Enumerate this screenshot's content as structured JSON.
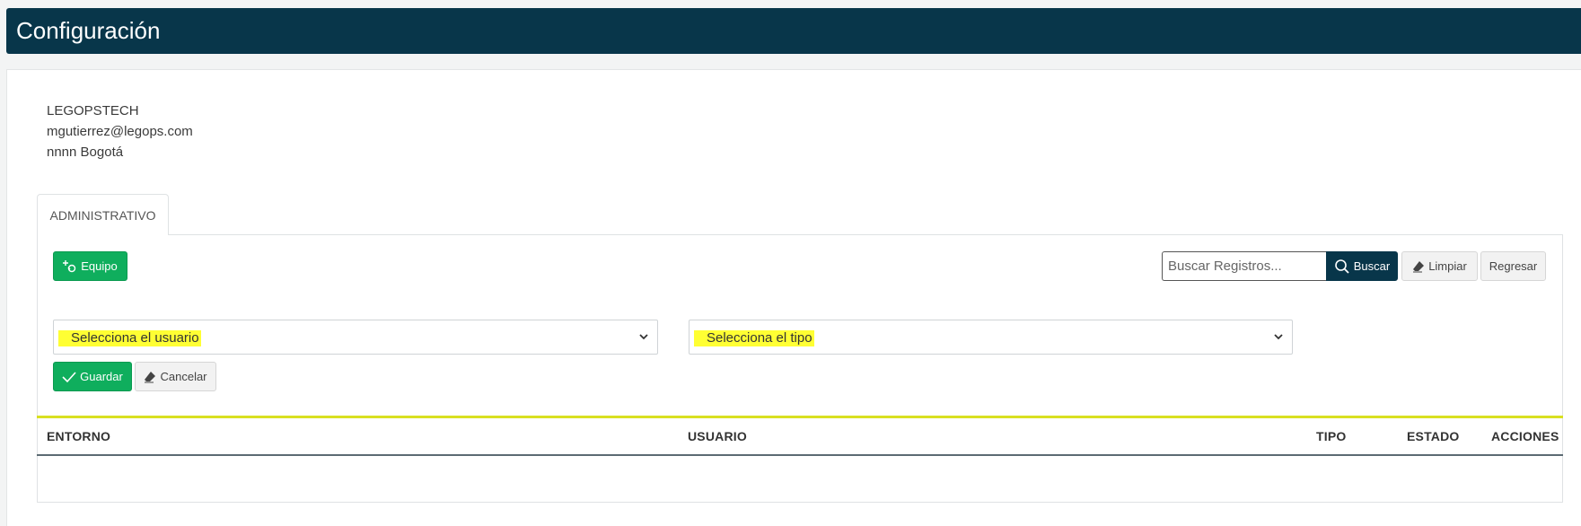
{
  "header": {
    "title": "Configuración"
  },
  "account": {
    "company": "LEGOPSTECH",
    "email": "mgutierrez@legops.com",
    "location": "nnnn Bogotá"
  },
  "tabs": [
    {
      "label": "ADMINISTRATIVO",
      "active": true
    }
  ],
  "toolbar": {
    "add_team_label": "Equipo",
    "search_placeholder": "Buscar Registros...",
    "search_value": "",
    "search_label": "Buscar",
    "clear_label": "Limpiar",
    "back_label": "Regresar"
  },
  "form": {
    "user_select": "Selecciona el usuario",
    "type_select": "Selecciona el tipo",
    "save_label": "Guardar",
    "cancel_label": "Cancelar"
  },
  "table": {
    "columns": [
      "ENTORNO",
      "USUARIO",
      "TIPO",
      "ESTADO",
      "ACCIONES"
    ],
    "rows": []
  },
  "colors": {
    "header_bg": "#08364a",
    "primary_green": "#0fae5d",
    "highlight": "#ffff33",
    "table_accent": "#d9e021"
  },
  "icons": {
    "add_team": "add-user-icon",
    "search": "search-icon",
    "clear": "eraser-icon",
    "save": "check-icon",
    "cancel": "eraser-icon",
    "dropdown": "chevron-down-icon"
  }
}
